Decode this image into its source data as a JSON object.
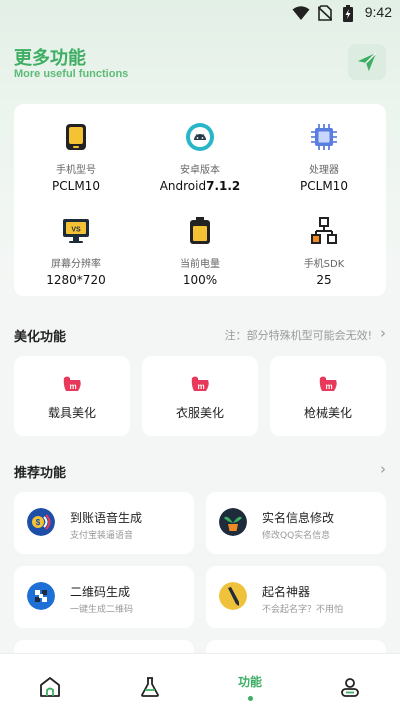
{
  "status": {
    "time": "9:42"
  },
  "header": {
    "title": "更多功能",
    "subtitle": "More useful functions"
  },
  "device_info": [
    {
      "label": "手机型号",
      "value": "PCLM10",
      "icon": "phone-icon"
    },
    {
      "label": "安卓版本",
      "value_prefix": "Android",
      "value_bold": "7.1.2",
      "icon": "android-icon"
    },
    {
      "label": "处理器",
      "value": "PCLM10",
      "icon": "chip-icon"
    },
    {
      "label": "屏幕分辨率",
      "value": "1280*720",
      "icon": "monitor-icon"
    },
    {
      "label": "当前电量",
      "value": "100%",
      "icon": "battery-icon"
    },
    {
      "label": "手机SDK",
      "value": "25",
      "icon": "network-icon"
    }
  ],
  "beauty_section": {
    "title": "美化功能",
    "note": "注：部分特殊机型可能会无效!",
    "items": [
      {
        "label": "载具美化",
        "icon": "beauty-icon"
      },
      {
        "label": "衣服美化",
        "icon": "beauty-icon"
      },
      {
        "label": "枪械美化",
        "icon": "beauty-icon"
      }
    ]
  },
  "recommend_section": {
    "title": "推荐功能",
    "items": [
      {
        "title": "到账语音生成",
        "subtitle": "支付宝装逼语音",
        "icon": "payment-voice-icon"
      },
      {
        "title": "实名信息修改",
        "subtitle": "修改QQ实名信息",
        "icon": "plant-icon"
      },
      {
        "title": "二维码生成",
        "subtitle": "一键生成二维码",
        "icon": "qrcode-icon"
      },
      {
        "title": "起名神器",
        "subtitle": "不会起名字？不用怕",
        "icon": "pen-icon"
      }
    ]
  },
  "bottom_nav": {
    "items": [
      {
        "name": "home",
        "icon": "home-icon"
      },
      {
        "name": "lab",
        "icon": "flask-icon"
      },
      {
        "name": "function",
        "label": "功能",
        "active": true
      },
      {
        "name": "profile",
        "icon": "user-icon"
      }
    ]
  },
  "colors": {
    "accent": "#3dae63",
    "card": "#ffffff",
    "background": "#f4f5f5"
  }
}
